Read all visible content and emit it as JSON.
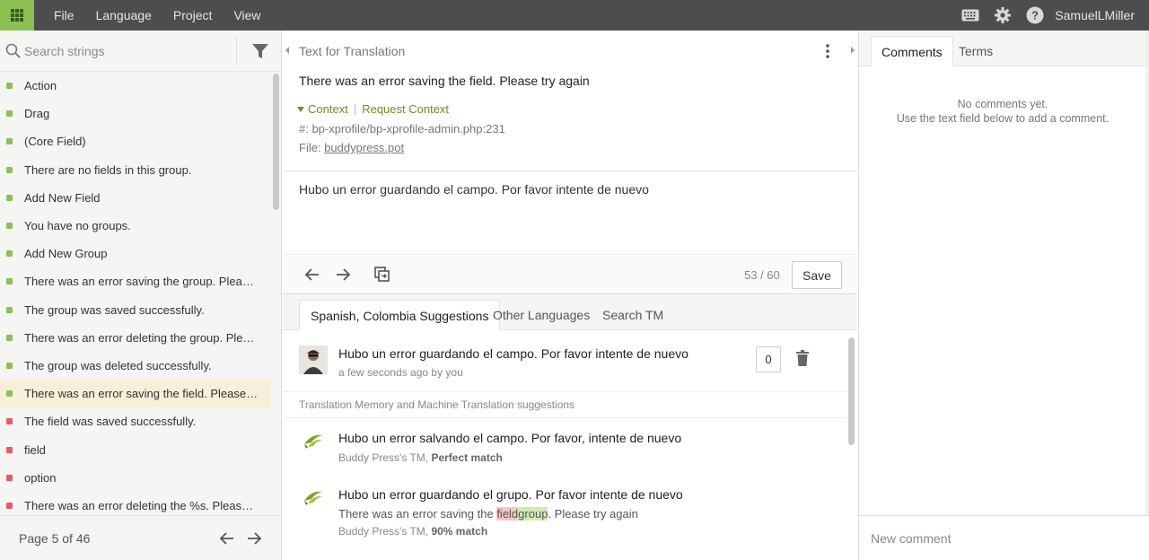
{
  "topbar": {
    "menu": [
      "File",
      "Language",
      "Project",
      "View"
    ],
    "username": "SamuelLMiller",
    "icons": [
      "apps-grid-icon",
      "keyboard-icon",
      "gear-icon",
      "help-icon"
    ]
  },
  "left": {
    "search_placeholder": "Search strings",
    "strings": [
      {
        "text": "Action",
        "status": "green"
      },
      {
        "text": "Drag",
        "status": "green"
      },
      {
        "text": "(Core Field)",
        "status": "green"
      },
      {
        "text": "There are no fields in this group.",
        "status": "green"
      },
      {
        "text": "Add New Field",
        "status": "green"
      },
      {
        "text": "You have no groups.",
        "status": "green"
      },
      {
        "text": "Add New Group",
        "status": "green"
      },
      {
        "text": "There was an error saving the group. Please tr...",
        "status": "green"
      },
      {
        "text": "The group was saved successfully.",
        "status": "green"
      },
      {
        "text": "There was an error deleting the group. Please t...",
        "status": "green"
      },
      {
        "text": "The group was deleted successfully.",
        "status": "green"
      },
      {
        "text": "There was an error saving the field. Please try ...",
        "status": "green",
        "active": true
      },
      {
        "text": "The field was saved successfully.",
        "status": "red"
      },
      {
        "text": "field",
        "status": "red"
      },
      {
        "text": "option",
        "status": "red"
      },
      {
        "text": "There was an error deleting the %s. Please try ...",
        "status": "red"
      }
    ],
    "pager": {
      "label": "Page 5 of 46"
    }
  },
  "editor": {
    "header": "Text for Translation",
    "source": "There was an error saving the field. Please try again",
    "context_label": "Context",
    "request_context_label": "Request Context",
    "reference": "#: bp-xprofile/bp-xprofile-admin.php:231",
    "file_prefix": "File:",
    "file_name": "buddypress.pot",
    "translation": "Hubo un error guardando el campo. Por favor intente de nuevo",
    "counter": "53 / 60",
    "save_label": "Save"
  },
  "suggestions": {
    "tabs": [
      "Spanish, Colombia Suggestions",
      "Other Languages",
      "Search TM"
    ],
    "own": {
      "text": "Hubo un error guardando el campo. Por favor intente de nuevo",
      "meta": "a few seconds ago by you",
      "votes": "0"
    },
    "tm_header": "Translation Memory and Machine Translation suggestions",
    "tm": [
      {
        "text": "Hubo un error salvando el campo. Por favor, intente de nuevo",
        "meta_source": "Buddy Press's TM,",
        "meta_match": "Perfect match"
      },
      {
        "text": "Hubo un error guardando el grupo. Por favor intente de nuevo",
        "diff_before": "There was an error saving the ",
        "diff_del": "field",
        "diff_ins": "group",
        "diff_after": ". Please try again",
        "meta_source": "Buddy Press's TM,",
        "meta_match": "90% match"
      }
    ]
  },
  "right": {
    "tabs": [
      "Comments",
      "Terms"
    ],
    "no_comments_line1": "No comments yet.",
    "no_comments_line2": "Use the text field below to add a comment.",
    "new_comment_placeholder": "New comment"
  },
  "colors": {
    "accent": "#8cc152",
    "topbar": "#4d4d4d",
    "context": "#6b8e23",
    "status_green": "#8cc152",
    "status_red": "#e85b64",
    "active_row": "#f7efd9"
  }
}
